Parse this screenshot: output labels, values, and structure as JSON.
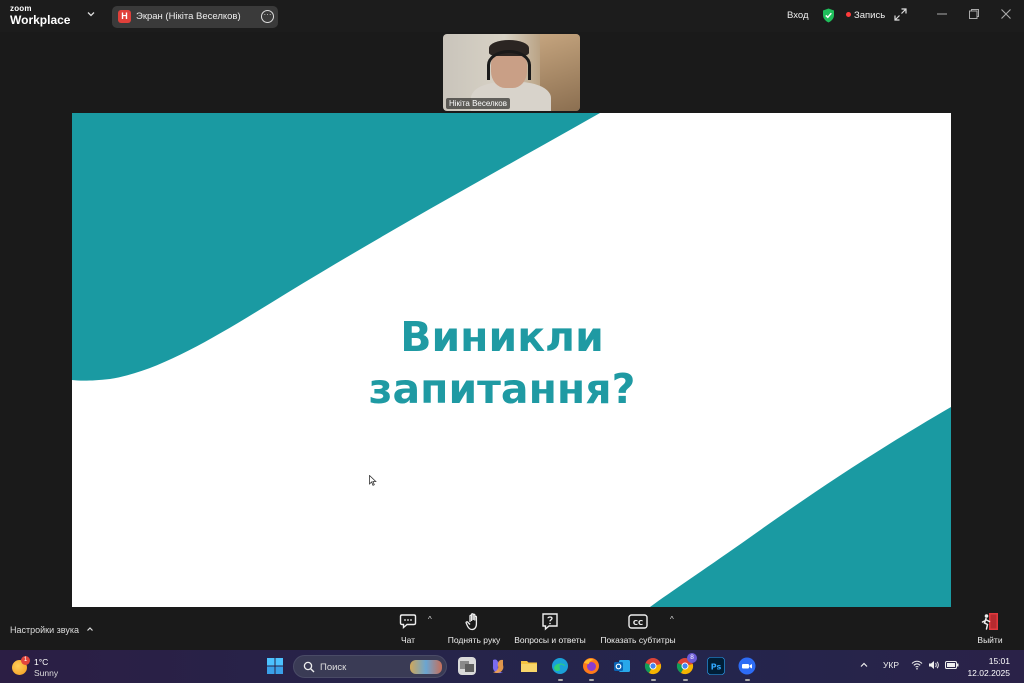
{
  "app": {
    "brand_small": "zoom",
    "brand_big": "Workplace"
  },
  "share": {
    "badge": "Н",
    "label": "Экран (Нікіта Веселков)",
    "more_icon": "ellipsis-icon"
  },
  "topbar": {
    "signin": "Вход",
    "record": "Запись",
    "shield_color": "#1fbf5b"
  },
  "video": {
    "participant_name": "Нікіта Веселков"
  },
  "slide": {
    "line1": "Виникли",
    "line2": "запитання?",
    "accent": "#1a9aa2"
  },
  "controls": {
    "audio_settings": "Настройки звука",
    "chat": "Чат",
    "raise_hand": "Поднять руку",
    "qa": "Вопросы и ответы",
    "captions": "Показать субтитры",
    "leave": "Выйти"
  },
  "taskbar": {
    "weather_badge": "1",
    "weather_temp": "1°C",
    "weather_cond": "Sunny",
    "search_placeholder": "Поиск",
    "chrome_badge": "8",
    "language": "УКР",
    "time": "15:01",
    "date": "12.02.2025"
  }
}
